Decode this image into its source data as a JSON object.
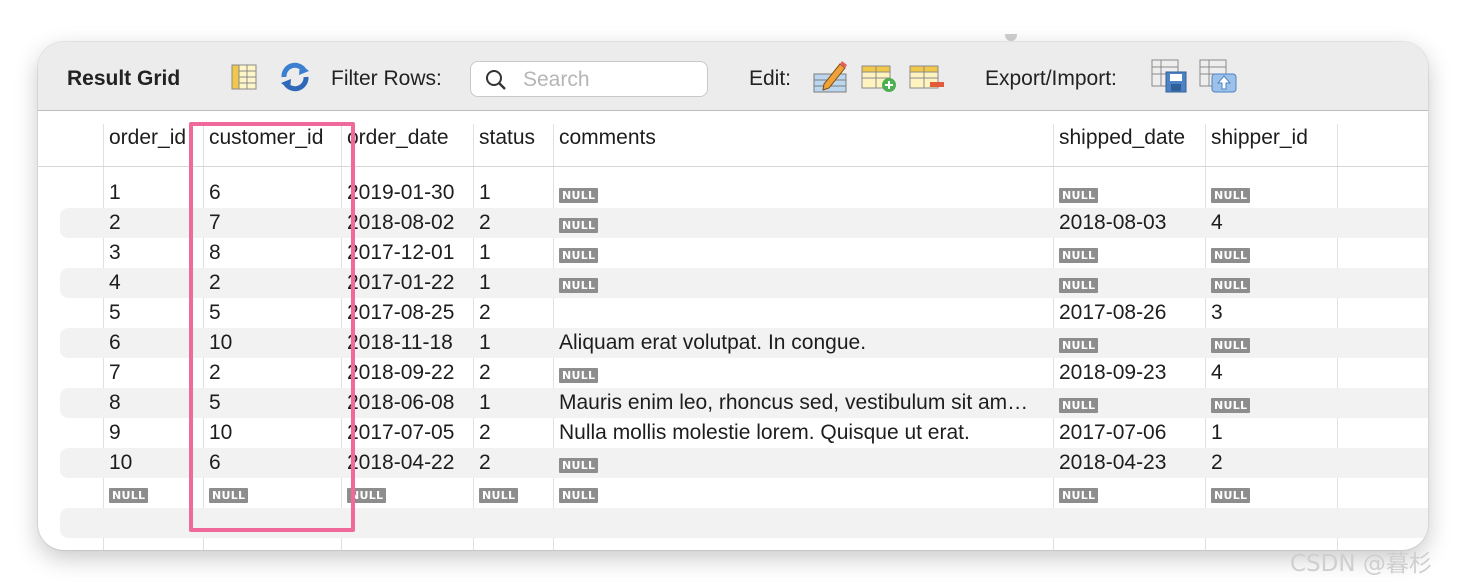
{
  "toolbar": {
    "title": "Result Grid",
    "filter_label": "Filter Rows:",
    "search_placeholder": "Search",
    "edit_label": "Edit:",
    "export_label": "Export/Import:",
    "icons": [
      "form-view-icon",
      "refresh-icon",
      "search-icon",
      "edit-row-icon",
      "add-row-icon",
      "delete-row-icon",
      "export-icon",
      "import-icon"
    ]
  },
  "grid": {
    "columns": [
      "order_id",
      "customer_id",
      "order_date",
      "status",
      "comments",
      "shipped_date",
      "shipper_id"
    ],
    "null_label": "NULL",
    "rows": [
      [
        "1",
        "6",
        "2019-01-30",
        "1",
        null,
        null,
        null
      ],
      [
        "2",
        "7",
        "2018-08-02",
        "2",
        null,
        "2018-08-03",
        "4"
      ],
      [
        "3",
        "8",
        "2017-12-01",
        "1",
        null,
        null,
        null
      ],
      [
        "4",
        "2",
        "2017-01-22",
        "1",
        null,
        null,
        null
      ],
      [
        "5",
        "5",
        "2017-08-25",
        "2",
        "",
        "2017-08-26",
        "3"
      ],
      [
        "6",
        "10",
        "2018-11-18",
        "1",
        "Aliquam erat volutpat. In congue.",
        null,
        null
      ],
      [
        "7",
        "2",
        "2018-09-22",
        "2",
        null,
        "2018-09-23",
        "4"
      ],
      [
        "8",
        "5",
        "2018-06-08",
        "1",
        "Mauris enim leo, rhoncus sed, vestibulum sit am…",
        null,
        null
      ],
      [
        "9",
        "10",
        "2017-07-05",
        "2",
        "Nulla mollis molestie lorem. Quisque ut erat.",
        "2017-07-06",
        "1"
      ],
      [
        "10",
        "6",
        "2018-04-22",
        "2",
        null,
        "2018-04-23",
        "2"
      ],
      [
        null,
        null,
        null,
        null,
        null,
        null,
        null
      ]
    ]
  },
  "annotation": {
    "highlight_color": "#ef6a9b",
    "highlighted_column": "customer_id"
  },
  "watermark": "CSDN @暮杉"
}
